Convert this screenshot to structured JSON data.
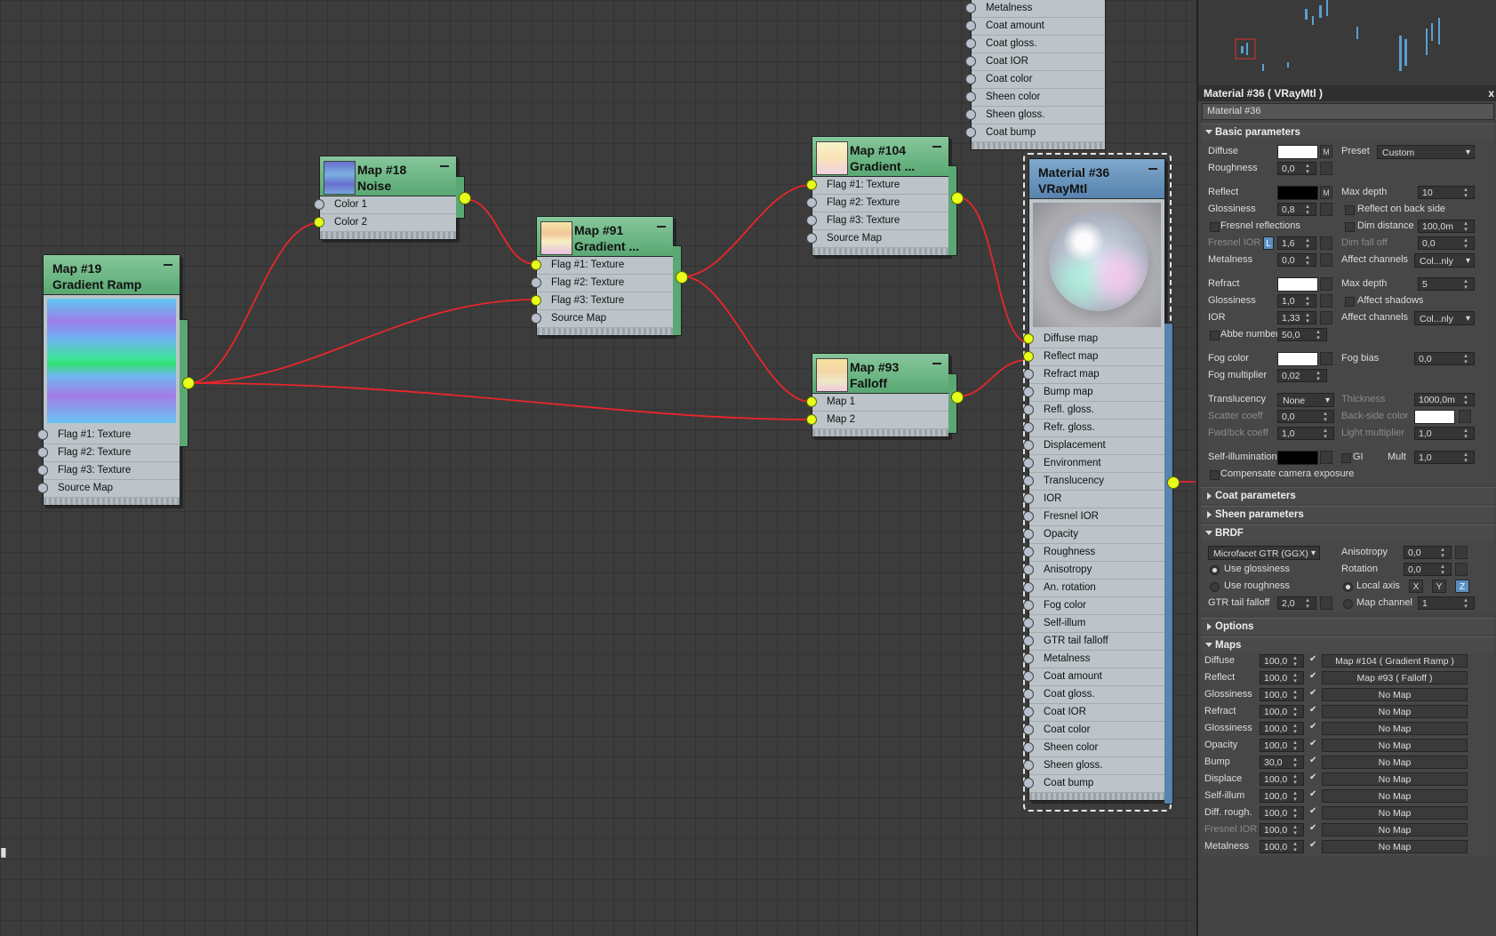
{
  "nodes": {
    "gradient_ramp_19": {
      "title_line1": "Map #19",
      "title_line2": "Gradient Ramp",
      "slots": [
        "Flag #1: Texture",
        "Flag #2: Texture",
        "Flag #3: Texture",
        "Source Map"
      ]
    },
    "noise_18": {
      "title_line1": "Map #18",
      "title_line2": "Noise",
      "slots": [
        "Color 1",
        "Color 2"
      ]
    },
    "gradient_91": {
      "title_line1": "Map #91",
      "title_line2": "Gradient ...",
      "slots": [
        "Flag #1: Texture",
        "Flag #2: Texture",
        "Flag #3: Texture",
        "Source Map"
      ]
    },
    "gradient_104": {
      "title_line1": "Map #104",
      "title_line2": "Gradient ...",
      "slots": [
        "Flag #1: Texture",
        "Flag #2: Texture",
        "Flag #3: Texture",
        "Source Map"
      ]
    },
    "falloff_93": {
      "title_line1": "Map #93",
      "title_line2": "Falloff",
      "slots": [
        "Map 1",
        "Map 2"
      ]
    },
    "material_36": {
      "title_line1": "Material #36",
      "title_line2": "VRayMtl",
      "slots": [
        "Diffuse map",
        "Reflect map",
        "Refract map",
        "Bump map",
        "Refl. gloss.",
        "Refr. gloss.",
        "Displacement",
        "Environment",
        "Translucency",
        "IOR",
        "Fresnel IOR",
        "Opacity",
        "Roughness",
        "Anisotropy",
        "An. rotation",
        "Fog color",
        "Self-illum",
        "GTR tail falloff",
        "Metalness",
        "Coat amount",
        "Coat gloss.",
        "Coat IOR",
        "Coat color",
        "Sheen color",
        "Sheen gloss.",
        "Coat bump"
      ]
    },
    "top_partial_slots": [
      "Metalness",
      "Coat amount",
      "Coat gloss.",
      "Coat IOR",
      "Coat color",
      "Sheen color",
      "Sheen gloss.",
      "Coat bump"
    ]
  },
  "panel": {
    "header": "Material #36  ( VRayMtl )",
    "close": "x",
    "name_field": "Material #36",
    "basic": {
      "title": "Basic parameters",
      "diffuse": "Diffuse",
      "m": "M",
      "preset": "Preset",
      "preset_value": "Custom",
      "roughness": "Roughness",
      "roughness_value": "0,0",
      "reflect": "Reflect",
      "max_depth": "Max depth",
      "reflect_max_depth_value": "10",
      "glossiness": "Glossiness",
      "refl_gloss_value": "0,8",
      "reflect_back_side": "Reflect on back side",
      "fresnel_reflections": "Fresnel reflections",
      "dim_distance": "Dim distance",
      "dim_distance_value": "100,0m",
      "fresnel_ior": "Fresnel IOR",
      "l": "L",
      "fresnel_ior_value": "1,6",
      "dim_falloff": "Dim fall off",
      "dim_falloff_value": "0,0",
      "metalness": "Metalness",
      "metalness_value": "0,0",
      "affect_channels": "Affect channels",
      "affect_channels_value": "Col...nly",
      "refract": "Refract",
      "refract_max_depth_value": "5",
      "refr_gloss_value": "1,0",
      "affect_shadows": "Affect shadows",
      "ior": "IOR",
      "ior_value": "1,33",
      "abbe_number": "Abbe number",
      "abbe_value": "50,0",
      "fog_color": "Fog color",
      "fog_bias": "Fog bias",
      "fog_bias_value": "0,0",
      "fog_multiplier": "Fog multiplier",
      "fog_multiplier_value": "0,02",
      "translucency": "Translucency",
      "translucency_value": "None",
      "thickness": "Thickness",
      "thickness_value": "1000,0m",
      "scatter_coeff": "Scatter coeff",
      "scatter_value": "0,0",
      "back_side_color": "Back-side color",
      "fwd_bck_coeff": "Fwd/bck coeff",
      "fwd_value": "1,0",
      "light_multiplier": "Light multiplier",
      "light_mult_value": "1,0",
      "self_illumination": "Self-illumination",
      "gi": "GI",
      "mult": "Mult",
      "mult_value": "1,0",
      "compensate": "Compensate camera exposure"
    },
    "coat": "Coat parameters",
    "sheen": "Sheen parameters",
    "brdf": {
      "title": "BRDF",
      "type": "Microfacet GTR (GGX)",
      "anisotropy": "Anisotropy",
      "anisotropy_value": "0,0",
      "rotation": "Rotation",
      "rotation_value": "0,0",
      "use_glossiness": "Use glossiness",
      "use_roughness": "Use roughness",
      "local_axis": "Local axis",
      "x": "X",
      "y": "Y",
      "z": "Z",
      "gtr_tail_falloff": "GTR tail falloff",
      "gtr_value": "2,0",
      "map_channel": "Map channel",
      "map_channel_value": "1"
    },
    "options": "Options",
    "maps": {
      "title": "Maps",
      "rows": [
        {
          "label": "Diffuse",
          "amount": "100,0",
          "check": "✔",
          "map": "Map #104  ( Gradient Ramp )",
          "disabled": false
        },
        {
          "label": "Reflect",
          "amount": "100,0",
          "check": "✔",
          "map": "Map #93  ( Falloff )",
          "disabled": false
        },
        {
          "label": "Glossiness",
          "amount": "100,0",
          "check": "✔",
          "map": "No Map",
          "disabled": false
        },
        {
          "label": "Refract",
          "amount": "100,0",
          "check": "✔",
          "map": "No Map",
          "disabled": false
        },
        {
          "label": "Glossiness",
          "amount": "100,0",
          "check": "✔",
          "map": "No Map",
          "disabled": false
        },
        {
          "label": "Opacity",
          "amount": "100,0",
          "check": "✔",
          "map": "No Map",
          "disabled": false
        },
        {
          "label": "Bump",
          "amount": "30,0",
          "check": "✔",
          "map": "No Map",
          "disabled": false
        },
        {
          "label": "Displace",
          "amount": "100,0",
          "check": "✔",
          "map": "No Map",
          "disabled": false
        },
        {
          "label": "Self-illum",
          "amount": "100,0",
          "check": "✔",
          "map": "No Map",
          "disabled": false
        },
        {
          "label": "Diff. rough.",
          "amount": "100,0",
          "check": "✔",
          "map": "No Map",
          "disabled": false
        },
        {
          "label": "Fresnel IOR",
          "amount": "100,0",
          "check": "✔",
          "map": "No Map",
          "disabled": true
        },
        {
          "label": "Metalness",
          "amount": "100,0",
          "check": "✔",
          "map": "No Map",
          "disabled": false
        }
      ]
    }
  },
  "colors": {
    "wire": "#e8262b",
    "socket_active": "#e7ff1a",
    "map_header": "#5aa873",
    "material_header": "#5783ad"
  }
}
